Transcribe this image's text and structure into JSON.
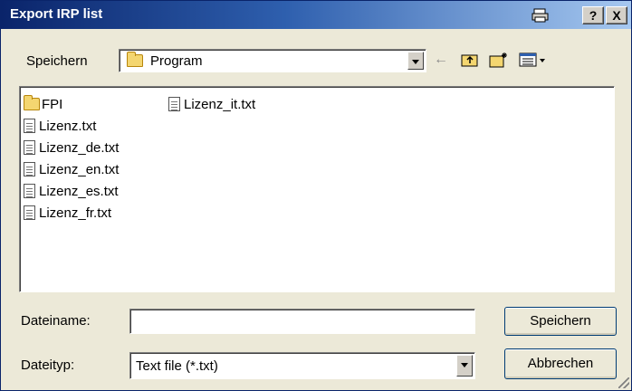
{
  "window": {
    "title": "Export IRP list",
    "help_label": "?",
    "close_label": "X",
    "print_icon": "printer-icon"
  },
  "save_in": {
    "label": "Speichern",
    "value": "Program"
  },
  "toolbar": {
    "back": "←",
    "up": "folder-up-icon",
    "new_folder": "new-folder-icon",
    "view": "view-menu-icon"
  },
  "files": {
    "col1": [
      {
        "name": "FPI",
        "type": "folder"
      },
      {
        "name": "Lizenz.txt",
        "type": "file"
      },
      {
        "name": "Lizenz_de.txt",
        "type": "file"
      },
      {
        "name": "Lizenz_en.txt",
        "type": "file"
      },
      {
        "name": "Lizenz_es.txt",
        "type": "file"
      },
      {
        "name": "Lizenz_fr.txt",
        "type": "file"
      }
    ],
    "col2": [
      {
        "name": "Lizenz_it.txt",
        "type": "file"
      }
    ]
  },
  "filename": {
    "label": "Dateiname:",
    "value": ""
  },
  "filetype": {
    "label": "Dateityp:",
    "value": "Text file (*.txt)"
  },
  "buttons": {
    "save": "Speichern",
    "cancel": "Abbrechen"
  }
}
